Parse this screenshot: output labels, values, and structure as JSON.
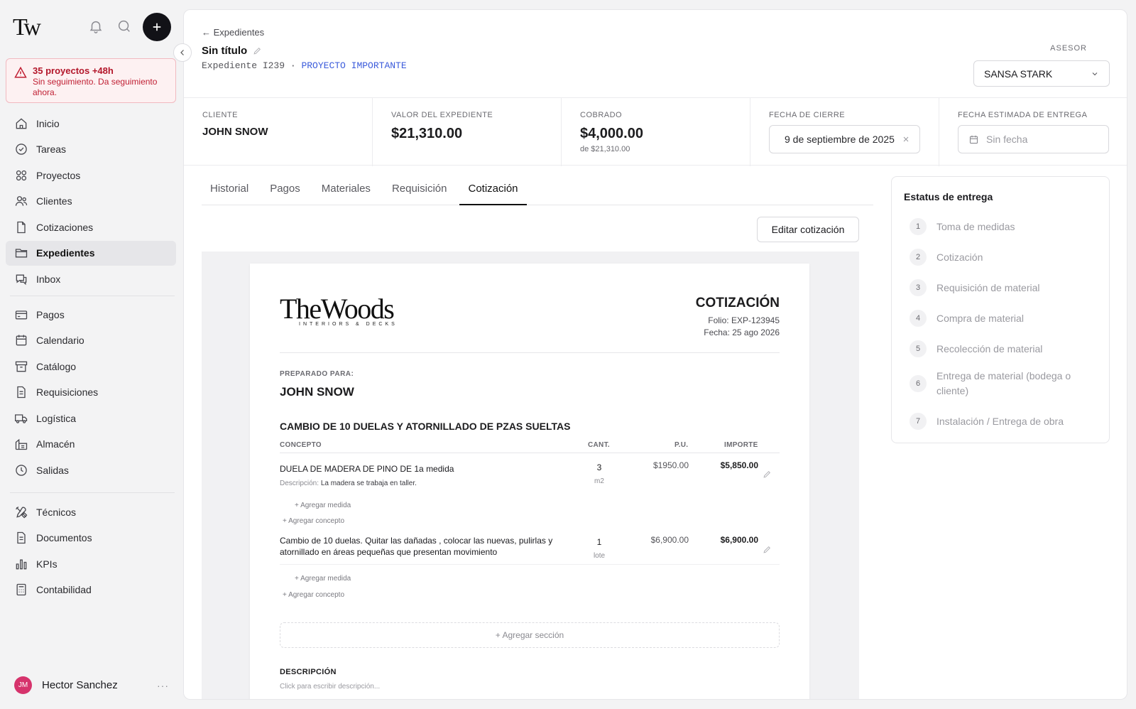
{
  "app": {
    "logo": "Tw"
  },
  "alert": {
    "title": "35 proyectos +48h",
    "message": "Sin seguimiento. Da seguimiento ahora."
  },
  "sidebar": {
    "group1": [
      {
        "label": "Inicio",
        "icon": "home-icon"
      },
      {
        "label": "Tareas",
        "icon": "check-circle-icon"
      },
      {
        "label": "Proyectos",
        "icon": "grid-icon"
      },
      {
        "label": "Clientes",
        "icon": "users-icon"
      },
      {
        "label": "Cotizaciones",
        "icon": "file-icon"
      },
      {
        "label": "Expedientes",
        "icon": "folder-icon",
        "active": true
      },
      {
        "label": "Inbox",
        "icon": "chat-icon"
      }
    ],
    "group2": [
      {
        "label": "Pagos",
        "icon": "card-icon"
      },
      {
        "label": "Calendario",
        "icon": "calendar-icon"
      },
      {
        "label": "Catálogo",
        "icon": "archive-icon"
      },
      {
        "label": "Requisiciones",
        "icon": "document-icon"
      },
      {
        "label": "Logística",
        "icon": "truck-icon"
      },
      {
        "label": "Almacén",
        "icon": "warehouse-icon"
      },
      {
        "label": "Salidas",
        "icon": "clock-icon"
      }
    ],
    "group3": [
      {
        "label": "Técnicos",
        "icon": "tools-icon"
      },
      {
        "label": "Documentos",
        "icon": "document-icon"
      },
      {
        "label": "KPIs",
        "icon": "bar-chart-icon"
      },
      {
        "label": "Contabilidad",
        "icon": "calculator-icon"
      }
    ]
  },
  "user": {
    "initials": "JM",
    "name": "Hector Sanchez",
    "more": "···"
  },
  "header": {
    "back": "← Expedientes",
    "title": "Sin título",
    "expediente": "Expediente I239 · ",
    "tag": "PROYECTO IMPORTANTE",
    "asesor_label": "ASESOR",
    "asesor_value": "SANSA STARK"
  },
  "kpis": {
    "cliente_label": "CLIENTE",
    "cliente_value": "JOHN SNOW",
    "valor_label": "VALOR DEL EXPEDIENTE",
    "valor_value": "$21,310.00",
    "cobrado_label": "COBRADO",
    "cobrado_value": "$4,000.00",
    "cobrado_sub": "de $21,310.00",
    "cierre_label": "FECHA DE CIERRE",
    "cierre_value": "9 de septiembre de 2025",
    "entrega_label": "FECHA ESTIMADA DE ENTREGA",
    "entrega_placeholder": "Sin fecha"
  },
  "tabs": [
    "Historial",
    "Pagos",
    "Materiales",
    "Requisición",
    "Cotización"
  ],
  "active_tab": "Cotización",
  "edit_button": "Editar cotización",
  "quote": {
    "brand": "TheWoods",
    "brand_sub": "INTERIORS & DECKS",
    "title": "COTIZACIÓN",
    "folio": "Folio: EXP-123945",
    "fecha": "Fecha: 25 ago 2026",
    "prepared_label": "PREPARADO PARA:",
    "prepared_name": "JOHN SNOW",
    "section_title": "CAMBIO DE 10 DUELAS Y ATORNILLADO DE PZAS SUELTAS",
    "columns": {
      "concepto": "CONCEPTO",
      "cant": "CANT.",
      "pu": "P.U.",
      "importe": "IMPORTE"
    },
    "rows": [
      {
        "concepto": "DUELA DE MADERA DE PINO DE 1a medida",
        "desc_label": "Descripción:",
        "desc": "La madera se trabaja en taller.",
        "cant": "3",
        "unit": "m2",
        "pu": "$1950.00",
        "importe": "$5,850.00"
      },
      {
        "concepto": "Cambio de 10 duelas. Quitar las dañadas , colocar las nuevas, pulirlas y atornillado en áreas pequeñas que presentan movimiento",
        "cant": "1",
        "unit": "lote",
        "pu": "$6,900.00",
        "importe": "$6,900.00"
      }
    ],
    "add_medida": "+ Agregar medida",
    "add_concepto": "+ Agregar concepto",
    "add_section": "+ Agregar sección",
    "descripcion_title": "DESCRIPCIÓN",
    "descripcion_hint": "Click para escribir descripción..."
  },
  "status": {
    "title": "Estatus de entrega",
    "steps": [
      {
        "n": "1",
        "label": "Toma de medidas"
      },
      {
        "n": "2",
        "label": "Cotización"
      },
      {
        "n": "3",
        "label": "Requisición de material"
      },
      {
        "n": "4",
        "label": "Compra de material"
      },
      {
        "n": "5",
        "label": "Recolección de material"
      },
      {
        "n": "6",
        "label": "Entrega de material (bodega o cliente)"
      },
      {
        "n": "7",
        "label": "Instalación / Entrega de obra"
      }
    ]
  }
}
